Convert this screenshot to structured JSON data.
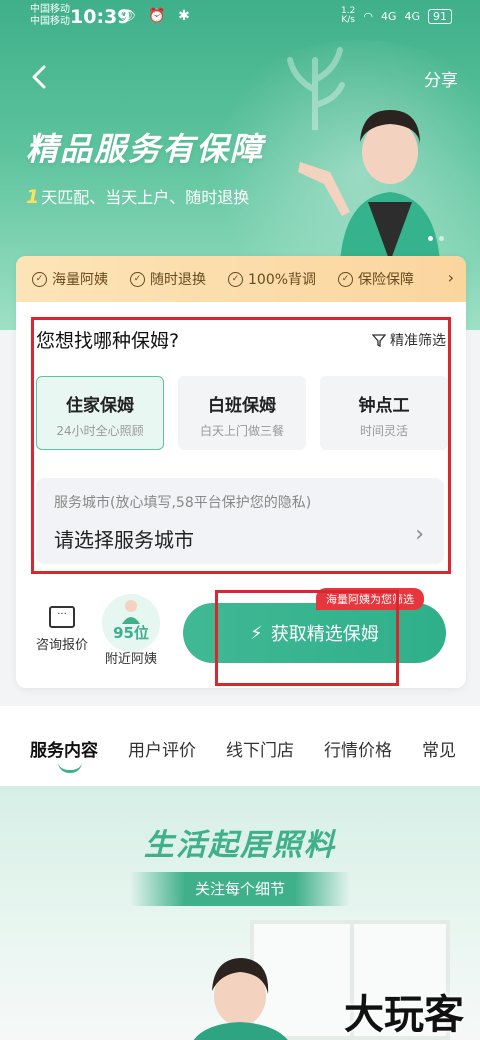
{
  "status_bar": {
    "carrier_1": "中国移动",
    "carrier_2": "中国移动",
    "time": "10:39",
    "icons": "👁 ⏰ ✱",
    "net_speed_value": "1.2",
    "net_speed_unit": "K/s",
    "signal_1": "4G",
    "signal_2": "4G",
    "battery": "91"
  },
  "header": {
    "back_icon": "chevron-left-icon",
    "share_label": "分享"
  },
  "hero": {
    "title": "精品服务有保障",
    "subtitle_num": "1",
    "subtitle_text": "天匹配、当天上户、随时退换"
  },
  "guarantees": [
    "海量阿姨",
    "随时退换",
    "100%背调",
    "保险保障"
  ],
  "finder": {
    "question": "您想找哪种保姆?",
    "filter_label": "精准筛选",
    "types": [
      {
        "name": "住家保姆",
        "desc": "24小时全心照顾",
        "selected": true
      },
      {
        "name": "白班保姆",
        "desc": "白天上门做三餐",
        "selected": false
      },
      {
        "name": "钟点工",
        "desc": "时间灵活",
        "selected": false
      }
    ],
    "city_hint": "服务城市(放心填写,58平台保护您的隐私)",
    "city_placeholder": "请选择服务城市"
  },
  "actions": {
    "consult_label": "咨询报价",
    "nearby_count": "95位",
    "nearby_label": "附近阿姨",
    "cta_label": "获取精选保姆",
    "cta_badge": "海量阿姨为您筛选"
  },
  "tabs": [
    "服务内容",
    "用户评价",
    "线下门店",
    "行情价格",
    "常见"
  ],
  "banner": {
    "title": "生活起居照料",
    "subtitle": "关注每个细节"
  },
  "watermark": "大玩客",
  "colors": {
    "brand_green": "#3fb08a",
    "highlight_red": "#d9262f",
    "guarantee_bg": "#fde4b8"
  }
}
